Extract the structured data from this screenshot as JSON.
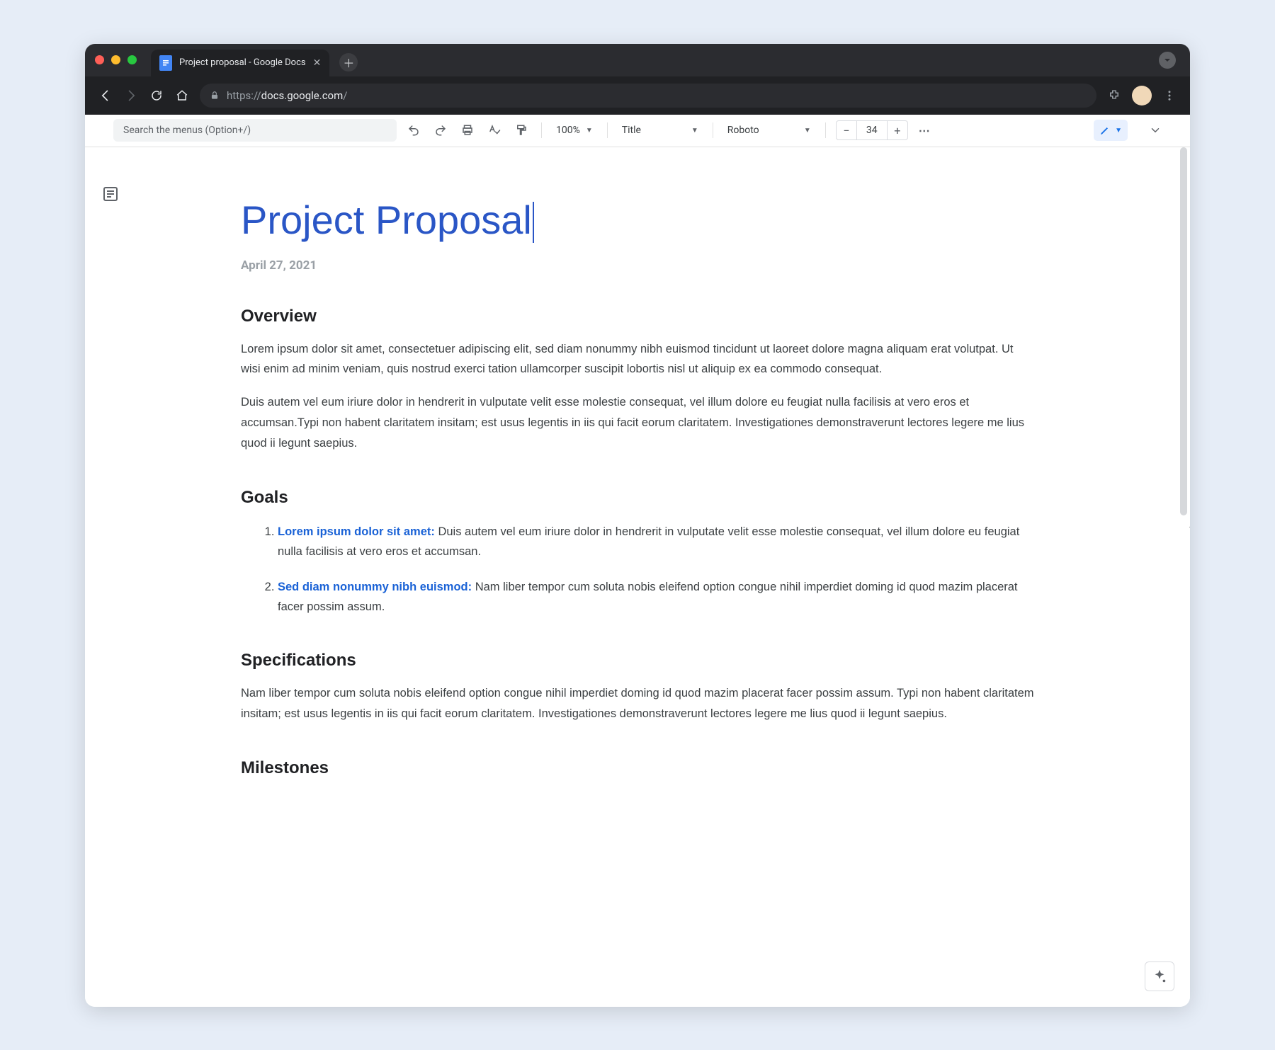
{
  "browser": {
    "tab_title": "Project proposal - Google Docs",
    "url_scheme": "https://",
    "url_host": "docs.google.com",
    "url_path": "/"
  },
  "toolbar": {
    "search_placeholder": "Search the menus (Option+/)",
    "zoom": "100%",
    "style": "Title",
    "font": "Roboto",
    "font_size": "34"
  },
  "document": {
    "title": "Project Proposal",
    "date": "April 27, 2021",
    "sections": {
      "overview": {
        "heading": "Overview",
        "p1": "Lorem ipsum dolor sit amet, consectetuer adipiscing elit, sed diam nonummy nibh euismod tincidunt ut laoreet dolore magna aliquam erat volutpat. Ut wisi enim ad minim veniam, quis nostrud exerci tation ullamcorper suscipit lobortis nisl ut aliquip ex ea commodo consequat.",
        "p2": "Duis autem vel eum iriure dolor in hendrerit in vulputate velit esse molestie consequat, vel illum dolore eu feugiat nulla facilisis at vero eros et accumsan.Typi non habent claritatem insitam; est usus legentis in iis qui facit eorum claritatem. Investigationes demonstraverunt lectores legere me lius quod ii legunt saepius."
      },
      "goals": {
        "heading": "Goals",
        "items": [
          {
            "lead": "Lorem ipsum dolor sit amet:",
            "rest": " Duis autem vel eum iriure dolor in hendrerit in vulputate velit esse molestie consequat, vel illum dolore eu feugiat nulla facilisis at vero eros et accumsan."
          },
          {
            "lead": "Sed diam nonummy nibh euismod:",
            "rest": " Nam liber tempor cum soluta nobis eleifend option congue nihil imperdiet doming id quod mazim placerat facer possim assum."
          }
        ]
      },
      "specifications": {
        "heading": "Specifications",
        "p1": "Nam liber tempor cum soluta nobis eleifend option congue nihil imperdiet doming id quod mazim placerat facer possim assum. Typi non habent claritatem insitam; est usus legentis in iis qui facit eorum claritatem. Investigationes demonstraverunt lectores legere me lius quod ii legunt saepius."
      },
      "milestones": {
        "heading": "Milestones"
      }
    }
  }
}
